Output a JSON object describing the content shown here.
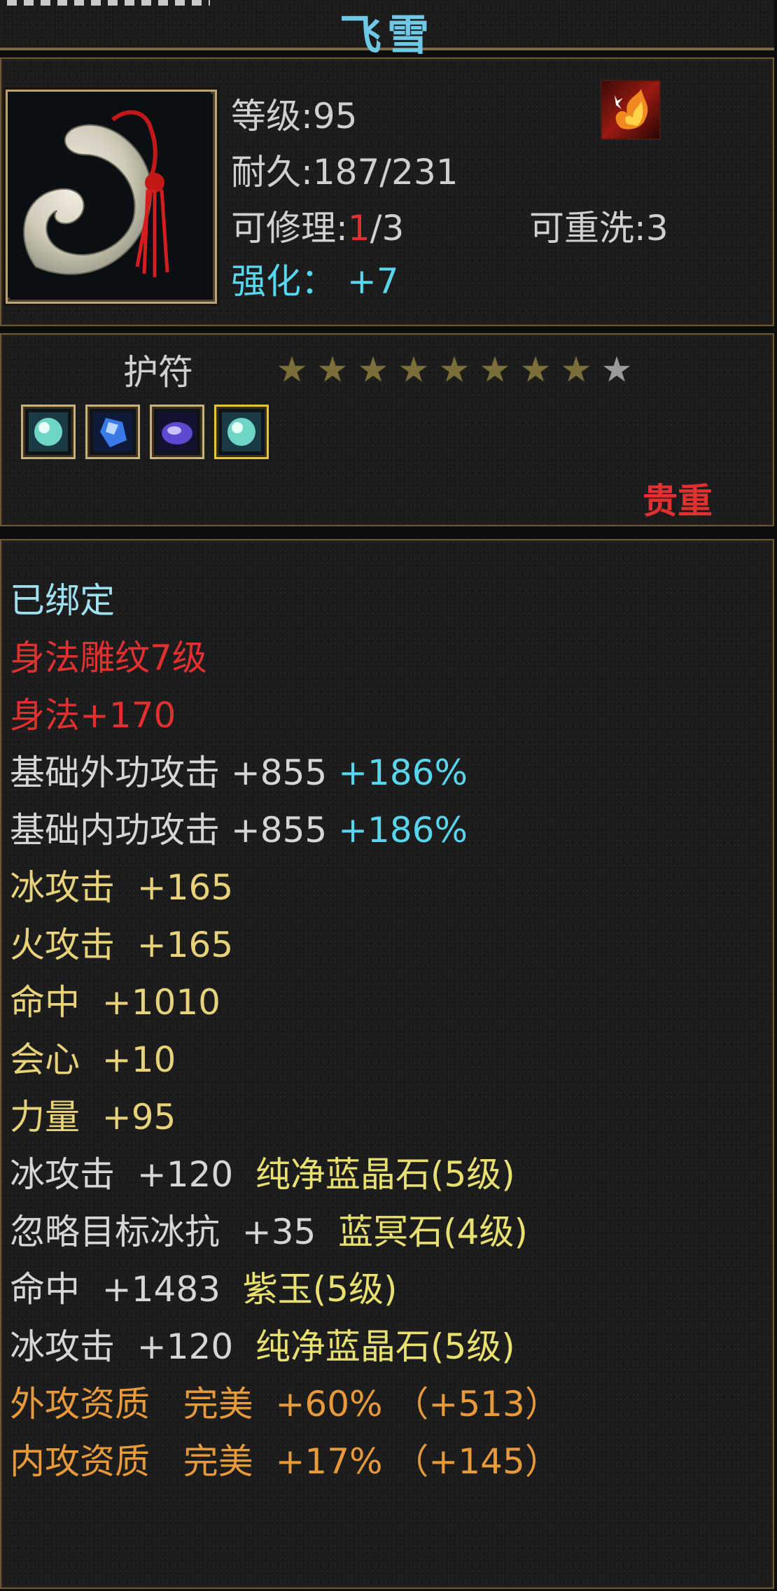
{
  "header": {
    "title": "飞雪"
  },
  "item": {
    "level_label": "等级",
    "level": "95",
    "durability_label": "耐久",
    "durability": "187/231",
    "repair_label": "可修理",
    "repair_used": "1",
    "repair_total": "/3",
    "rewash_label": "可重洗",
    "rewash": "3",
    "enhance_label": "强化：",
    "enhance": "+7",
    "type": "护符",
    "stars_filled": 8,
    "stars_total": 9,
    "quality_tag": "贵重",
    "gems": [
      "green-crystal-gem-icon",
      "blue-crystal-gem-icon",
      "purple-jade-gem-icon",
      "green-crystal-gem-icon"
    ]
  },
  "attributes": {
    "bound": "已绑定",
    "engraving": "身法雕纹7级",
    "agility": "身法+170",
    "base_ext_attack": {
      "label": "基础外功攻击",
      "value": "+855",
      "percent": "+186%"
    },
    "base_int_attack": {
      "label": "基础内功攻击",
      "value": "+855",
      "percent": "+186%"
    },
    "ice_attack": {
      "label": "冰攻击",
      "value": "+165"
    },
    "fire_attack": {
      "label": "火攻击",
      "value": "+165"
    },
    "hit": {
      "label": "命中",
      "value": "+1010"
    },
    "crit": {
      "label": "会心",
      "value": "+10"
    },
    "strength": {
      "label": "力量",
      "value": "+95"
    },
    "gem1": {
      "label": "冰攻击",
      "value": "+120",
      "gem": "纯净蓝晶石(5级)"
    },
    "gem2": {
      "label": "忽略目标冰抗",
      "value": "+35",
      "gem": "蓝冥石(4级)"
    },
    "gem3": {
      "label": "命中",
      "value": "+1483",
      "gem": "紫玉(5级)"
    },
    "gem4": {
      "label": "冰攻击",
      "value": "+120",
      "gem": "纯净蓝晶石(5级)"
    },
    "ext_aptitude": {
      "label": "外攻资质",
      "grade": "完美",
      "percent": "+60%",
      "bonus": "（+513）"
    },
    "int_aptitude": {
      "label": "内攻资质",
      "grade": "完美",
      "percent": "+17%",
      "bonus": "（+145）"
    }
  }
}
